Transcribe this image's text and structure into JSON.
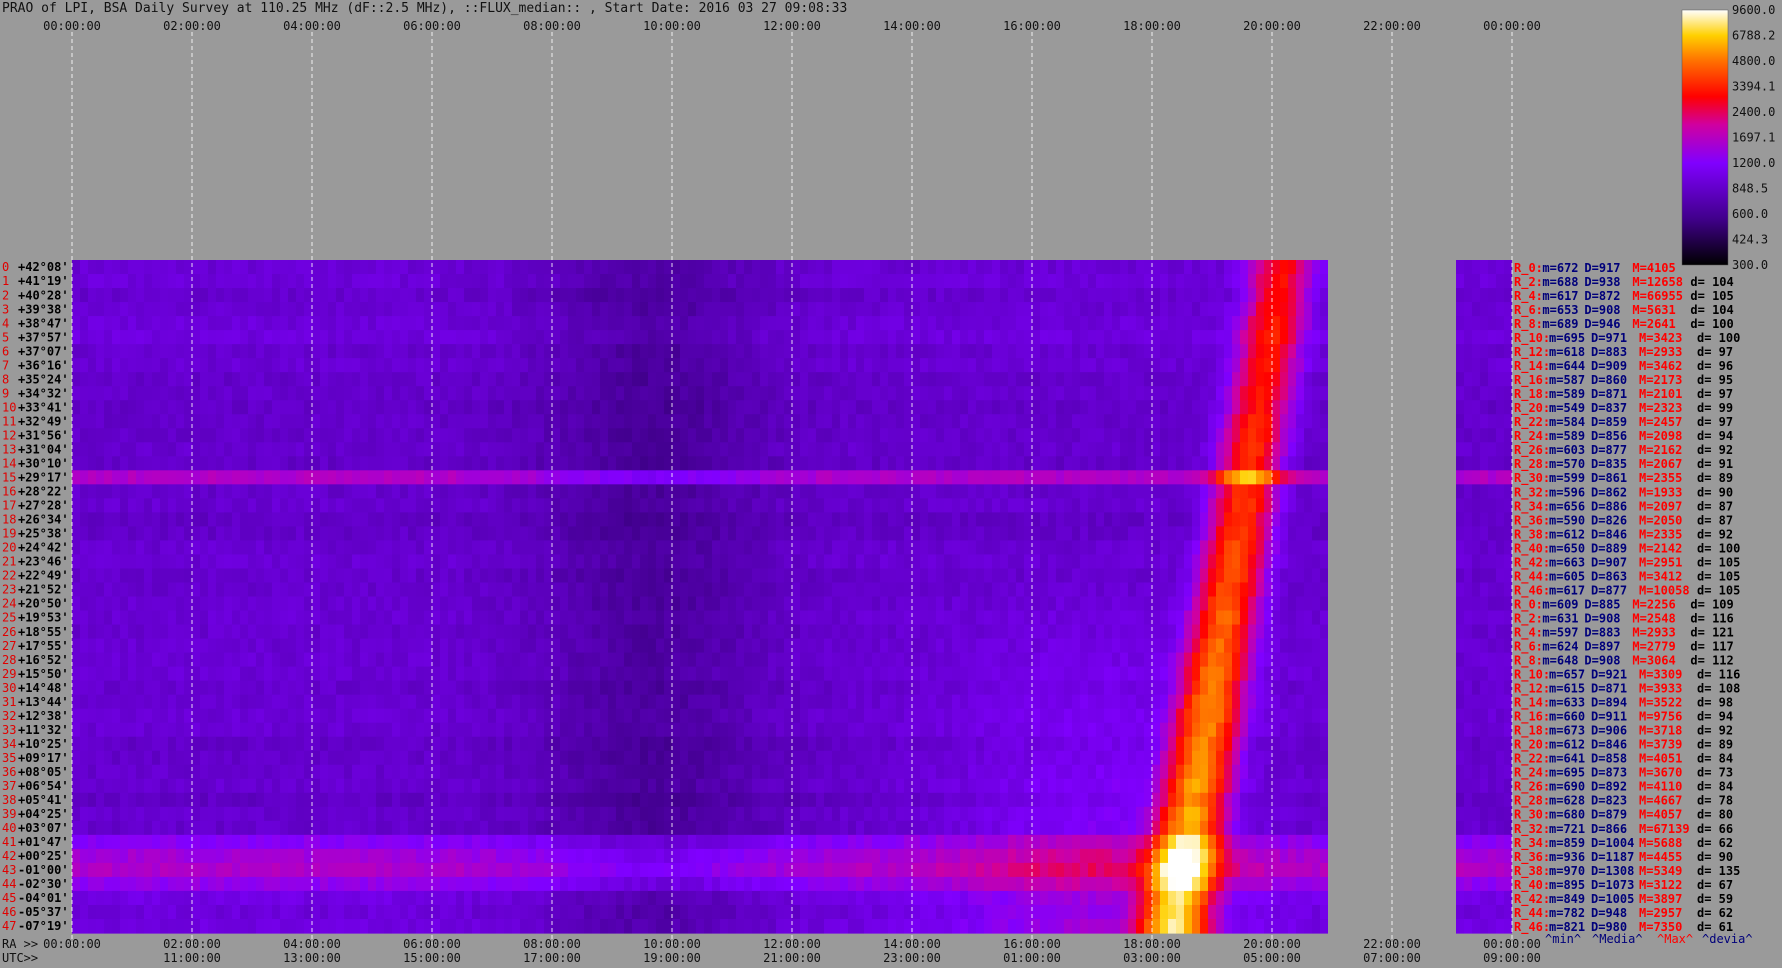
{
  "title": "PRAO of LPI, BSA Daily Survey at 110.25 MHz (dF::2.5 MHz), ::FLUX_median:: , Start Date: 2016 03 27 09:08:33",
  "chart_data": {
    "type": "heatmap",
    "top_axis_labels": [
      "00:00:00",
      "02:00:00",
      "04:00:00",
      "06:00:00",
      "08:00:00",
      "10:00:00",
      "12:00:00",
      "14:00:00",
      "16:00:00",
      "18:00:00",
      "20:00:00",
      "22:00:00",
      "00:00:00"
    ],
    "ra_row_prefix": "RA >>",
    "ra_labels": [
      "00:00:00",
      "02:00:00",
      "04:00:00",
      "06:00:00",
      "08:00:00",
      "10:00:00",
      "12:00:00",
      "14:00:00",
      "16:00:00",
      "18:00:00",
      "20:00:00",
      "22:00:00",
      "00:00:00"
    ],
    "utc_row_prefix": "UTC>>",
    "utc_labels": [
      "11:00:00",
      "13:00:00",
      "15:00:00",
      "17:00:00",
      "19:00:00",
      "21:00:00",
      "23:00:00",
      "01:00:00",
      "03:00:00",
      "05:00:00",
      "07:00:00",
      "09:00:00"
    ],
    "declinations": [
      "+42°08'",
      "+41°19'",
      "+40°28'",
      "+39°38'",
      "+38°47'",
      "+37°57'",
      "+37°07'",
      "+36°16'",
      "+35°24'",
      "+34°32'",
      "+33°41'",
      "+32°49'",
      "+31°56'",
      "+31°04'",
      "+30°10'",
      "+29°17'",
      "+28°22'",
      "+27°28'",
      "+26°34'",
      "+25°38'",
      "+24°42'",
      "+23°46'",
      "+22°49'",
      "+21°52'",
      "+20°50'",
      "+19°53'",
      "+18°55'",
      "+17°55'",
      "+16°52'",
      "+15°50'",
      "+14°48'",
      "+13°44'",
      "+12°38'",
      "+11°32'",
      "+10°25'",
      "+09°17'",
      "+08°05'",
      "+06°54'",
      "+05°41'",
      "+04°25'",
      "+03°07'",
      "+01°47'",
      "+00°25'",
      "-01°00'",
      "-02°30'",
      "-04°01'",
      "-05°37'",
      "-07°19'"
    ],
    "colorbar_ticks": [
      "9600.0",
      "6788.2",
      "4800.0",
      "3394.1",
      "2400.0",
      "1697.1",
      "1200.0",
      "848.5",
      "600.0",
      "424.3",
      "300.0"
    ],
    "colorbar_range": [
      300,
      9600
    ],
    "colors": {
      "background": "#9a9a9a",
      "low": "#000000",
      "mid": "#8000ff",
      "high": "#ff0000",
      "top": "#ffffff",
      "stat_blue": "#00007a",
      "stat_red": "#ff0000",
      "row_index_red": "#e00000"
    },
    "stats": [
      {
        "label": "R_0:",
        "min": "672",
        "median": "917",
        "max": "4105",
        "dev": ""
      },
      {
        "label": "R_2:",
        "min": "688",
        "median": "938",
        "max": "12658",
        "dev": "104"
      },
      {
        "label": "R_4:",
        "min": "617",
        "median": "872",
        "max": "66955",
        "dev": "105"
      },
      {
        "label": "R_6:",
        "min": "653",
        "median": "908",
        "max": "5631",
        "dev": "104"
      },
      {
        "label": "R_8:",
        "min": "689",
        "median": "946",
        "max": "2641",
        "dev": "100"
      },
      {
        "label": "R_10:",
        "min": "695",
        "median": "971",
        "max": "3423",
        "dev": "100"
      },
      {
        "label": "R_12:",
        "min": "618",
        "median": "883",
        "max": "2933",
        "dev": "97"
      },
      {
        "label": "R_14:",
        "min": "644",
        "median": "909",
        "max": "3462",
        "dev": "96"
      },
      {
        "label": "R_16:",
        "min": "587",
        "median": "860",
        "max": "2173",
        "dev": "95"
      },
      {
        "label": "R_18:",
        "min": "589",
        "median": "871",
        "max": "2101",
        "dev": "97"
      },
      {
        "label": "R_20:",
        "min": "549",
        "median": "837",
        "max": "2323",
        "dev": "99"
      },
      {
        "label": "R_22:",
        "min": "584",
        "median": "859",
        "max": "2457",
        "dev": "97"
      },
      {
        "label": "R_24:",
        "min": "589",
        "median": "856",
        "max": "2098",
        "dev": "94"
      },
      {
        "label": "R_26:",
        "min": "603",
        "median": "877",
        "max": "2162",
        "dev": "92"
      },
      {
        "label": "R_28:",
        "min": "570",
        "median": "835",
        "max": "2067",
        "dev": "91"
      },
      {
        "label": "R_30:",
        "min": "599",
        "median": "861",
        "max": "2355",
        "dev": "89"
      },
      {
        "label": "R_32:",
        "min": "596",
        "median": "862",
        "max": "1933",
        "dev": "90"
      },
      {
        "label": "R_34:",
        "min": "656",
        "median": "886",
        "max": "2097",
        "dev": "87"
      },
      {
        "label": "R_36:",
        "min": "590",
        "median": "826",
        "max": "2050",
        "dev": "87"
      },
      {
        "label": "R_38:",
        "min": "612",
        "median": "846",
        "max": "2335",
        "dev": "92"
      },
      {
        "label": "R_40:",
        "min": "650",
        "median": "889",
        "max": "2142",
        "dev": "100"
      },
      {
        "label": "R_42:",
        "min": "663",
        "median": "907",
        "max": "2951",
        "dev": "105"
      },
      {
        "label": "R_44:",
        "min": "605",
        "median": "863",
        "max": "3412",
        "dev": "105"
      },
      {
        "label": "R_46:",
        "min": "617",
        "median": "877",
        "max": "10058",
        "dev": "105"
      },
      {
        "label": "R_0:",
        "min": "609",
        "median": "885",
        "max": "2256",
        "dev": "109"
      },
      {
        "label": "R_2:",
        "min": "631",
        "median": "908",
        "max": "2548",
        "dev": "116"
      },
      {
        "label": "R_4:",
        "min": "597",
        "median": "883",
        "max": "2933",
        "dev": "121"
      },
      {
        "label": "R_6:",
        "min": "624",
        "median": "897",
        "max": "2779",
        "dev": "117"
      },
      {
        "label": "R_8:",
        "min": "648",
        "median": "908",
        "max": "3064",
        "dev": "112"
      },
      {
        "label": "R_10:",
        "min": "657",
        "median": "921",
        "max": "3309",
        "dev": "116"
      },
      {
        "label": "R_12:",
        "min": "615",
        "median": "871",
        "max": "3933",
        "dev": "108"
      },
      {
        "label": "R_14:",
        "min": "633",
        "median": "894",
        "max": "3522",
        "dev": "98"
      },
      {
        "label": "R_16:",
        "min": "660",
        "median": "911",
        "max": "9756",
        "dev": "94"
      },
      {
        "label": "R_18:",
        "min": "673",
        "median": "906",
        "max": "3718",
        "dev": "92"
      },
      {
        "label": "R_20:",
        "min": "612",
        "median": "846",
        "max": "3739",
        "dev": "89"
      },
      {
        "label": "R_22:",
        "min": "641",
        "median": "858",
        "max": "4051",
        "dev": "84"
      },
      {
        "label": "R_24:",
        "min": "695",
        "median": "873",
        "max": "3670",
        "dev": "73"
      },
      {
        "label": "R_26:",
        "min": "690",
        "median": "892",
        "max": "4110",
        "dev": "84"
      },
      {
        "label": "R_28:",
        "min": "628",
        "median": "823",
        "max": "4667",
        "dev": "78"
      },
      {
        "label": "R_30:",
        "min": "680",
        "median": "879",
        "max": "4057",
        "dev": "80"
      },
      {
        "label": "R_32:",
        "min": "721",
        "median": "866",
        "max": "67139",
        "dev": "66"
      },
      {
        "label": "R_34:",
        "min": "859",
        "median": "1004",
        "max": "5688",
        "dev": "62"
      },
      {
        "label": "R_36:",
        "min": "936",
        "median": "1187",
        "max": "4455",
        "dev": "90"
      },
      {
        "label": "R_38:",
        "min": "970",
        "median": "1308",
        "max": "5349",
        "dev": "135"
      },
      {
        "label": "R_40:",
        "min": "895",
        "median": "1073",
        "max": "3122",
        "dev": "67"
      },
      {
        "label": "R_42:",
        "min": "849",
        "median": "1005",
        "max": "3897",
        "dev": "59"
      },
      {
        "label": "R_44:",
        "min": "782",
        "median": "948",
        "max": "2957",
        "dev": "62"
      },
      {
        "label": "R_46:",
        "min": "821",
        "median": "980",
        "max": "7350",
        "dev": "61"
      }
    ],
    "stats_footer": [
      "^min^",
      "^Media^",
      "^Max^",
      "^devia^"
    ]
  }
}
